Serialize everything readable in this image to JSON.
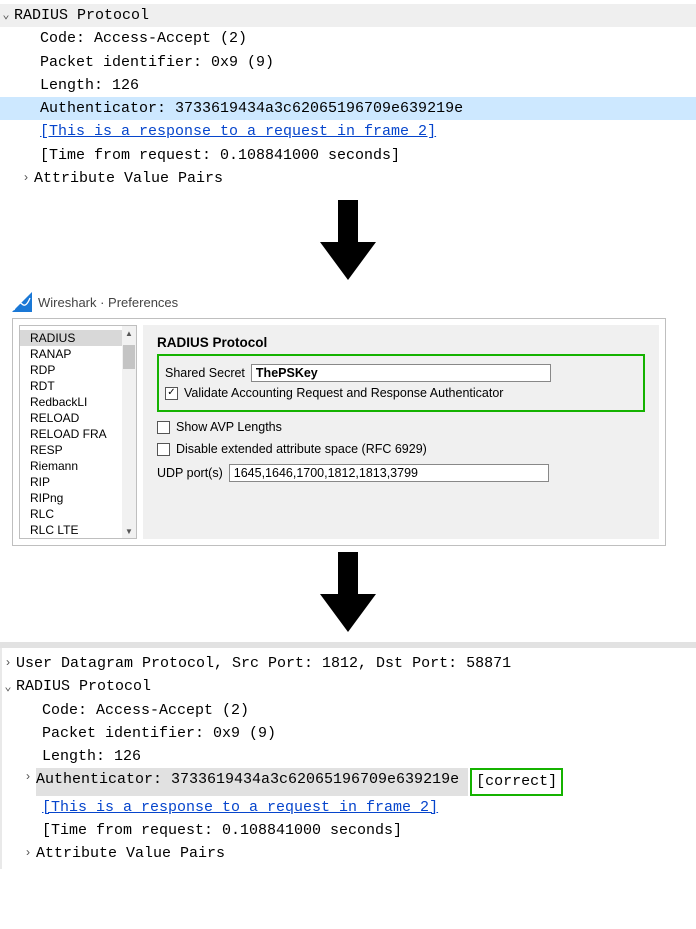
{
  "panel1": {
    "protocol_header": "RADIUS Protocol",
    "code": "Code: Access-Accept (2)",
    "pktid": "Packet identifier: 0x9 (9)",
    "length": "Length: 126",
    "authenticator": "Authenticator: 3733619434a3c62065196709e639219e",
    "response_link": "[This is a response to a request in frame 2]",
    "time_from_request": "[Time from request: 0.108841000 seconds]",
    "avp": "Attribute Value Pairs"
  },
  "prefs": {
    "window_title": "Wireshark · Preferences",
    "sidebar": [
      "RADIUS",
      "RANAP",
      "RDP",
      "RDT",
      "RedbackLI",
      "RELOAD",
      "RELOAD FRA",
      "RESP",
      "Riemann",
      "RIP",
      "RIPng",
      "RLC",
      "RLC  LTE"
    ],
    "heading": "RADIUS Protocol",
    "shared_secret_label": "Shared Secret",
    "shared_secret_value": "ThePSKey",
    "validate_label": "Validate Accounting Request and Response Authenticator",
    "show_avp_label": "Show AVP Lengths",
    "disable_ext_label": "Disable extended attribute space (RFC 6929)",
    "udp_label": "UDP port(s)",
    "udp_value": "1645,1646,1700,1812,1813,3799"
  },
  "panel3": {
    "udp": "User Datagram Protocol, Src Port: 1812, Dst Port: 58871",
    "protocol_header": "RADIUS Protocol",
    "code": "Code: Access-Accept (2)",
    "pktid": "Packet identifier: 0x9 (9)",
    "length": "Length: 126",
    "authenticator": "Authenticator: 3733619434a3c62065196709e639219e",
    "correct": "[correct]",
    "response_link": "[This is a response to a request in frame 2]",
    "time_from_request": "[Time from request: 0.108841000 seconds]",
    "avp": "Attribute Value Pairs"
  }
}
